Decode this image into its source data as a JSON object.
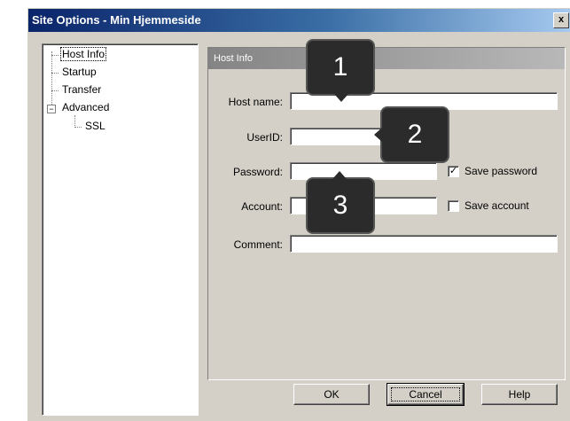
{
  "window": {
    "title": "Site Options - Min Hjemmeside",
    "close_glyph": "x"
  },
  "tree": {
    "items": [
      {
        "label": "Host Info",
        "selected": true
      },
      {
        "label": "Startup"
      },
      {
        "label": "Transfer"
      },
      {
        "label": "Advanced",
        "expander": "−"
      },
      {
        "label": "SSL"
      }
    ]
  },
  "panel": {
    "header": "Host Info",
    "fields": {
      "host_name": {
        "label": "Host name:",
        "value": ""
      },
      "user_id": {
        "label": "UserID:",
        "value": ""
      },
      "password": {
        "label": "Password:",
        "value": ""
      },
      "account": {
        "label": "Account:",
        "value": ""
      },
      "comment": {
        "label": "Comment:",
        "value": ""
      }
    },
    "save_password": {
      "label": "Save password",
      "checked": true,
      "mark": "✓"
    },
    "save_account": {
      "label": "Save account",
      "checked": false,
      "mark": ""
    }
  },
  "buttons": {
    "ok": "OK",
    "cancel": "Cancel",
    "help": "Help"
  },
  "callouts": [
    "1",
    "2",
    "3"
  ]
}
